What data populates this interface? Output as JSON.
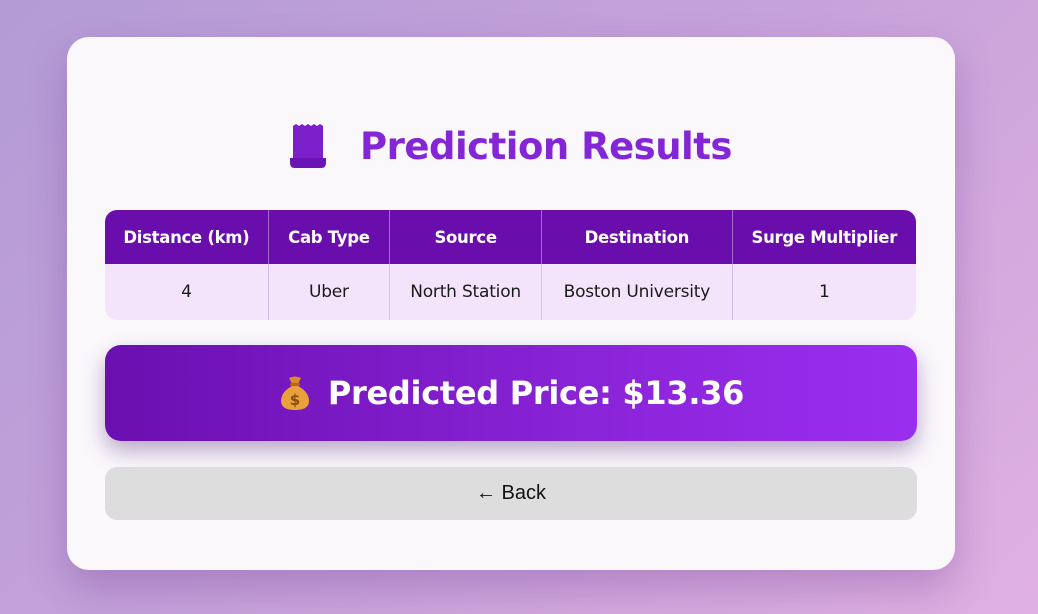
{
  "title": {
    "icon": "receipt-icon",
    "text": "Prediction Results"
  },
  "table": {
    "headers": [
      "Distance (km)",
      "Cab Type",
      "Source",
      "Destination",
      "Surge Multiplier"
    ],
    "row": [
      "4",
      "Uber",
      "North Station",
      "Boston University",
      "1"
    ]
  },
  "price": {
    "icon": "money-bag-icon",
    "text": "Predicted Price: $13.36"
  },
  "back_button": {
    "label": "← Back"
  },
  "colors": {
    "accent": "#8426d6",
    "table_header": "#6a0dad",
    "table_row": "#f3e4fb",
    "price_gradient_start": "#6a0fb0",
    "price_gradient_end": "#9a2ef0",
    "back_button_bg": "#dddddd"
  }
}
